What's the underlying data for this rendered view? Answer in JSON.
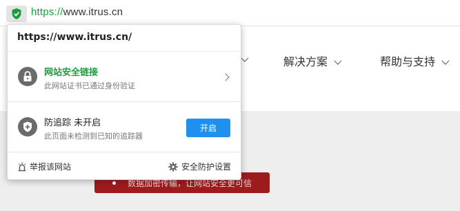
{
  "address_bar": {
    "url_scheme": "https://",
    "url_host": "www.itrus.cn",
    "shield_icon": "shield-check-icon",
    "shield_color": "#1a9e3c"
  },
  "page": {
    "nav": [
      {
        "label": ""
      },
      {
        "label": "解决方案"
      },
      {
        "label": "帮助与支持"
      }
    ],
    "banner_text": "数据加密传输，让网站安全更可信",
    "banner_color": "#9e1b1d"
  },
  "popup": {
    "site_url": "https://www.itrus.cn/",
    "security": {
      "title": "网站安全链接",
      "subtitle": "此网站证书已通过身份验证",
      "icon": "lock-icon",
      "accent": "#1a9e3c"
    },
    "tracking": {
      "title": "防追踪 未开启",
      "subtitle": "此页面未检测到已知的追踪器",
      "icon": "shield-plus-icon",
      "button_label": "开启",
      "button_color": "#1e90f0"
    },
    "footer": {
      "report_label": "举报该网站",
      "report_icon": "alarm-icon",
      "settings_label": "安全防护设置",
      "settings_icon": "gear-icon"
    }
  }
}
